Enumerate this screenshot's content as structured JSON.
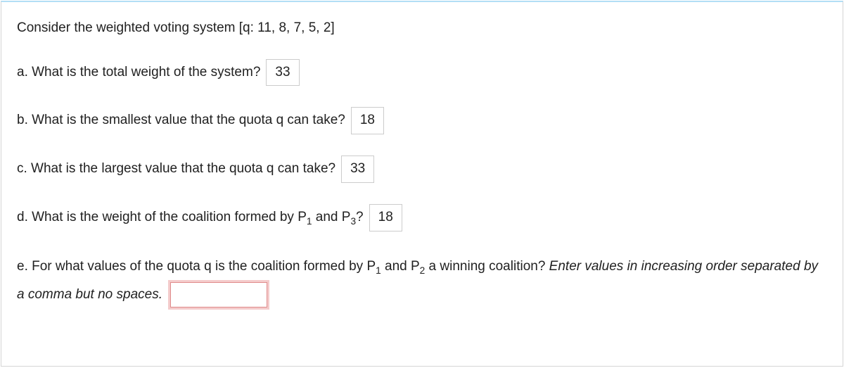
{
  "intro": "Consider the weighted voting system [q: 11, 8, 7, 5, 2]",
  "qa": {
    "label": "a. What is the total weight of the system?",
    "value": "33"
  },
  "qb": {
    "label": "b. What is the smallest value that the quota q can take?",
    "value": "18"
  },
  "qc": {
    "label": "c. What is the largest value that the quota q can take?",
    "value": "33"
  },
  "qd": {
    "prefix": "d. What is the weight of the coalition formed by P",
    "sub1": "1",
    "mid": " and P",
    "sub2": "3",
    "suffix": "?",
    "value": "18"
  },
  "qe": {
    "prefix": "e. For what values of the quota q is the coalition formed by P",
    "sub1": "1",
    "mid": " and P",
    "sub2": "2",
    "suffix": " a winning coalition? ",
    "hint1": "Enter values in increasing order",
    "hint2": "separated by a comma but no spaces.",
    "value": ""
  }
}
